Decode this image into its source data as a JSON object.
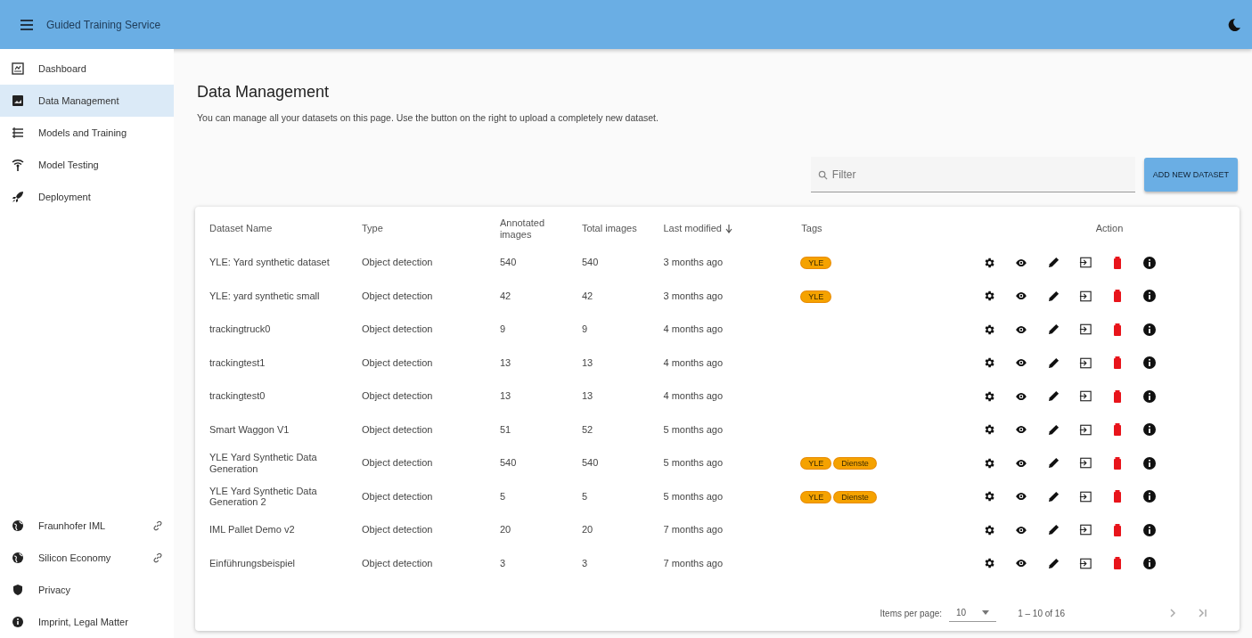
{
  "app_bar": {
    "title": "Guided Training Service"
  },
  "sidebar": {
    "items": [
      {
        "label": "Dashboard",
        "selected": false
      },
      {
        "label": "Data Management",
        "selected": true
      },
      {
        "label": "Models and Training",
        "selected": false
      },
      {
        "label": "Model Testing",
        "selected": false
      },
      {
        "label": "Deployment",
        "selected": false
      }
    ],
    "footer_items": [
      {
        "label": "Fraunhofer IML",
        "external_link": true
      },
      {
        "label": "Silicon Economy",
        "external_link": true
      },
      {
        "label": "Privacy",
        "external_link": false
      },
      {
        "label": "Imprint, Legal Matter",
        "external_link": false
      }
    ]
  },
  "page": {
    "title": "Data Management",
    "description": "You can manage all your datasets on this page. Use the button on the right to upload a completely new dataset."
  },
  "filter": {
    "placeholder": "Filter"
  },
  "add_button": "ADD NEW DATASET",
  "table": {
    "columns": [
      {
        "label": "Dataset Name",
        "sorted": false
      },
      {
        "label": "Type",
        "sorted": false
      },
      {
        "label": "Annotated images",
        "sorted": false
      },
      {
        "label": "Total images",
        "sorted": false
      },
      {
        "label": "Last modified",
        "sorted": true
      },
      {
        "label": "Tags",
        "sorted": false
      },
      {
        "label": "Action",
        "sorted": false
      }
    ],
    "rows": [
      {
        "name": "YLE: Yard synthetic dataset",
        "type": "Object detection",
        "annotated": "540",
        "total": "540",
        "modified": "3 months ago",
        "tags": [
          "YLE"
        ]
      },
      {
        "name": "YLE: yard synthetic small",
        "type": "Object detection",
        "annotated": "42",
        "total": "42",
        "modified": "3 months ago",
        "tags": [
          "YLE"
        ]
      },
      {
        "name": "trackingtruck0",
        "type": "Object detection",
        "annotated": "9",
        "total": "9",
        "modified": "4 months ago",
        "tags": []
      },
      {
        "name": "trackingtest1",
        "type": "Object detection",
        "annotated": "13",
        "total": "13",
        "modified": "4 months ago",
        "tags": []
      },
      {
        "name": "trackingtest0",
        "type": "Object detection",
        "annotated": "13",
        "total": "13",
        "modified": "4 months ago",
        "tags": []
      },
      {
        "name": "Smart Waggon V1",
        "type": "Object detection",
        "annotated": "51",
        "total": "52",
        "modified": "5 months ago",
        "tags": []
      },
      {
        "name": "YLE Yard Synthetic Data Generation",
        "type": "Object detection",
        "annotated": "540",
        "total": "540",
        "modified": "5 months ago",
        "tags": [
          "YLE",
          "Dienste"
        ]
      },
      {
        "name": "YLE Yard Synthetic Data Generation 2",
        "type": "Object detection",
        "annotated": "5",
        "total": "5",
        "modified": "5 months ago",
        "tags": [
          "YLE",
          "Dienste"
        ]
      },
      {
        "name": "IML Pallet Demo v2",
        "type": "Object detection",
        "annotated": "20",
        "total": "20",
        "modified": "7 months ago",
        "tags": []
      },
      {
        "name": "Einführungsbeispiel",
        "type": "Object detection",
        "annotated": "3",
        "total": "3",
        "modified": "7 months ago",
        "tags": []
      }
    ]
  },
  "paginator": {
    "label": "Items per page:",
    "page_size": "10",
    "range": "1 – 10 of 16"
  }
}
